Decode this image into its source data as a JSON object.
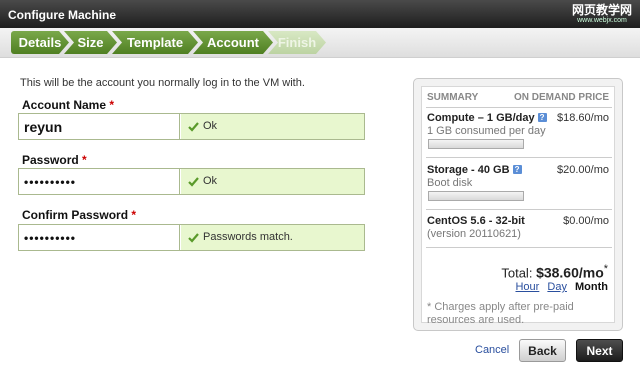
{
  "window": {
    "title": "Configure Machine",
    "close_glyph": "X"
  },
  "watermark": {
    "line1": "网页教学网",
    "line2": "www.webjx.com"
  },
  "steps": [
    {
      "label": "Details",
      "state": "done"
    },
    {
      "label": "Size",
      "state": "done"
    },
    {
      "label": "Template",
      "state": "done"
    },
    {
      "label": "Account",
      "state": "current"
    },
    {
      "label": "Finish",
      "state": "pending"
    }
  ],
  "intro": "This will be the account you normally log in to the VM with.",
  "fields": [
    {
      "label": "Account Name",
      "required_mark": "*",
      "value": "reyun",
      "status": "Ok"
    },
    {
      "label": "Password",
      "required_mark": "*",
      "value": "••••••••••",
      "status": "Ok"
    },
    {
      "label": "Confirm Password",
      "required_mark": "*",
      "value": "••••••••••",
      "status": "Passwords match."
    }
  ],
  "summary": {
    "heading_left": "SUMMARY",
    "heading_right": "ON DEMAND PRICE",
    "items": [
      {
        "name": "Compute – 1 GB/day",
        "info_icon": "?",
        "price": "$18.60/mo",
        "sub": "1 GB consumed per day"
      },
      {
        "name": "Storage - 40 GB",
        "info_icon": "?",
        "price": "$20.00/mo",
        "sub": "Boot disk"
      },
      {
        "name": "CentOS 5.6 - 32-bit",
        "price": "$0.00/mo",
        "sub": "(version 20110621)"
      }
    ],
    "total_label": "Total:",
    "total_value": "$38.60/mo",
    "total_mark": "*",
    "periods": {
      "hour": "Hour",
      "day": "Day",
      "month": "Month",
      "selected": "Month"
    },
    "note": "* Charges apply after pre-paid resources are used."
  },
  "actions": {
    "cancel": "Cancel",
    "back": "Back",
    "next": "Next"
  },
  "colors": {
    "step_active": "#5e8f2e",
    "status_bg": "#e8f7cf",
    "link": "#2a4f9e"
  }
}
